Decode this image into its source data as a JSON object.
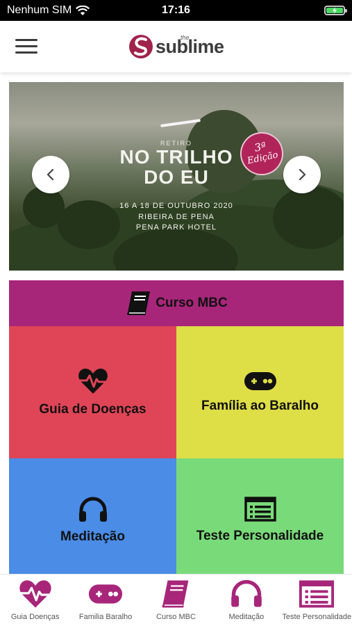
{
  "status_bar": {
    "carrier": "Nenhum SIM",
    "time": "17:16"
  },
  "header": {
    "logo_small": "the",
    "logo_name": "sublime",
    "brand_color": "#a0234c"
  },
  "banner": {
    "eyebrow": "RETIRO",
    "title_line1": "NO TRILHO",
    "title_line2": "DO EU",
    "badge_line1": "3ª",
    "badge_line2": "Edição",
    "dates": "16 A 18 DE OUTUBRO 2020",
    "place": "RIBEIRA DE PENA",
    "hotel": "PENA PARK HOTEL"
  },
  "grid": {
    "course": {
      "label": "Curso MBC",
      "color": "#a7267a",
      "icon": "book-icon"
    },
    "tiles": [
      {
        "label": "Guia de Doenças",
        "color": "#df4556",
        "icon": "heartbeat-icon"
      },
      {
        "label": "Família ao Baralho",
        "color": "#dede47",
        "icon": "gamepad-icon"
      },
      {
        "label": "Meditação",
        "color": "#4a8ce6",
        "icon": "headphones-icon"
      },
      {
        "label": "Teste Personalidade",
        "color": "#79da79",
        "icon": "list-icon"
      }
    ]
  },
  "tab_bar": {
    "accent": "#a7267a",
    "items": [
      {
        "label": "Guia Doenças",
        "icon": "heartbeat-icon"
      },
      {
        "label": "Familia Baralho",
        "icon": "gamepad-icon"
      },
      {
        "label": "Curso MBC",
        "icon": "book-icon"
      },
      {
        "label": "Meditação",
        "icon": "headphones-icon"
      },
      {
        "label": "Teste Personalidade",
        "icon": "list-icon"
      }
    ]
  }
}
